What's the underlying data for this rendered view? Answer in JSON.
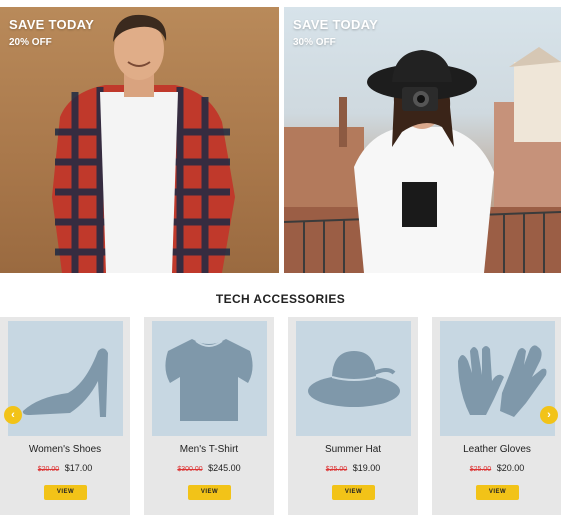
{
  "banners": [
    {
      "title": "SAVE TODAY",
      "subtitle": "20% OFF"
    },
    {
      "title": "SAVE TODAY",
      "subtitle": "30% OFF"
    }
  ],
  "section": {
    "title": "TECH ACCESSORIES"
  },
  "products": [
    {
      "name": "Women's Shoes",
      "old_price": "$20.00",
      "price": "$17.00",
      "view_label": "VIEW",
      "icon": "high-heel-shoe-icon"
    },
    {
      "name": "Men's T-Shirt",
      "old_price": "$300.00",
      "price": "$245.00",
      "view_label": "VIEW",
      "icon": "t-shirt-icon"
    },
    {
      "name": "Summer Hat",
      "old_price": "$25.00",
      "price": "$19.00",
      "view_label": "VIEW",
      "icon": "sun-hat-icon"
    },
    {
      "name": "Leather Gloves",
      "old_price": "$25.00",
      "price": "$20.00",
      "view_label": "VIEW",
      "icon": "gloves-icon"
    }
  ],
  "carousel": {
    "prev_icon": "‹",
    "next_icon": "›"
  },
  "colors": {
    "accent": "#f2c318",
    "thumb_bg": "#c7d7e2",
    "icon": "#7f98aa",
    "card_bg": "#e7e7e7",
    "old_price": "#dd3333"
  }
}
